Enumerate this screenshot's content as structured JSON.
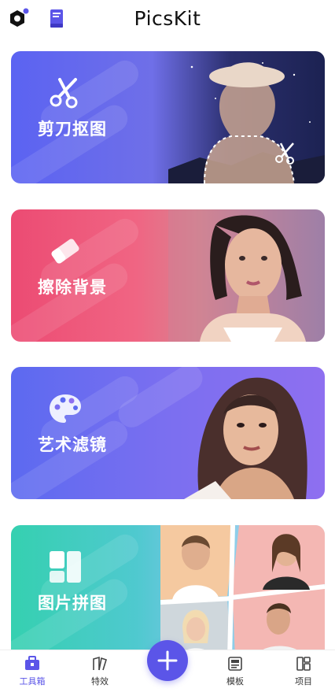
{
  "header": {
    "title": "PicsKit",
    "icons": [
      "hexagon-nut-icon",
      "book-icon"
    ],
    "notification_dot_color": "#5b55e8"
  },
  "cards": [
    {
      "label": "剪刀抠图",
      "icon": "scissors-icon",
      "accent": "#5b63f2"
    },
    {
      "label": "擦除背景",
      "icon": "eraser-icon",
      "accent": "#ec4b73"
    },
    {
      "label": "艺术滤镜",
      "icon": "palette-icon",
      "accent": "#5c6af0"
    },
    {
      "label": "图片拼图",
      "icon": "collage-icon",
      "accent": "#35d0b0"
    }
  ],
  "nav": {
    "items": [
      {
        "label": "工具箱",
        "icon": "toolbox-icon",
        "active": true
      },
      {
        "label": "特效",
        "icon": "effects-icon",
        "active": false
      },
      {
        "label": "模板",
        "icon": "template-icon",
        "active": false
      },
      {
        "label": "项目",
        "icon": "projects-icon",
        "active": false
      }
    ],
    "fab_icon": "plus-icon",
    "accent": "#5b55e8"
  }
}
